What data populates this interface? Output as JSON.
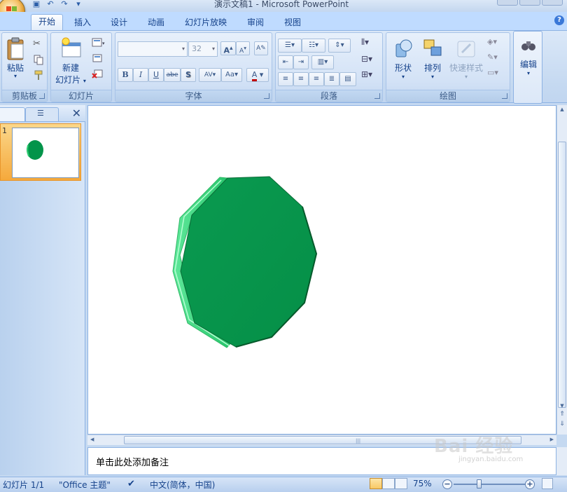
{
  "window": {
    "title": "演示文稿1 - Microsoft PowerPoint"
  },
  "tabs": [
    "开始",
    "插入",
    "设计",
    "动画",
    "幻灯片放映",
    "审阅",
    "视图"
  ],
  "ribbon": {
    "clipboard": {
      "label": "剪贴板",
      "paste": "粘贴"
    },
    "slides": {
      "label": "幻灯片",
      "new_slide_line1": "新建",
      "new_slide_line2": "幻灯片"
    },
    "font": {
      "label": "字体",
      "size": "32"
    },
    "paragraph": {
      "label": "段落"
    },
    "drawing": {
      "label": "绘图",
      "shapes": "形状",
      "arrange": "排列",
      "quick_styles": "快速样式"
    },
    "editing": {
      "label": "编辑"
    }
  },
  "notes": {
    "placeholder": "单击此处添加备注"
  },
  "statusbar": {
    "slide_count": "幻灯片 1/1",
    "theme": "\"Office 主题\"",
    "language": "中文(简体，中国)",
    "zoom": "75%"
  },
  "slide": {
    "shape_color": "#03944a",
    "shape_side_color": "#2ecf72"
  },
  "watermark": {
    "text": "Bai 经验",
    "sub": "jingyan.baidu.com"
  }
}
